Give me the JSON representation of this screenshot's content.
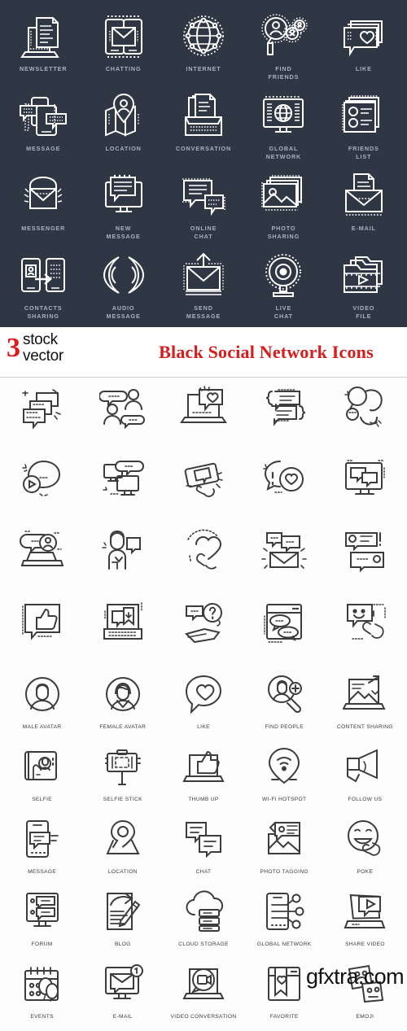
{
  "header": {
    "background_color": "#2f3744",
    "label_color": "#aab1bf",
    "icon_color": "#ffffff",
    "rows": [
      [
        {
          "label": "NEWSLETTER",
          "icon": "laptop-document-icon"
        },
        {
          "label": "CHATTING",
          "icon": "two-phones-envelope-icon"
        },
        {
          "label": "INTERNET",
          "icon": "globe-network-icon"
        },
        {
          "label": "FIND\nFRIENDS",
          "icon": "magnifier-people-icon"
        },
        {
          "label": "LIKE",
          "icon": "speech-bubble-heart-icon"
        }
      ],
      [
        {
          "label": "MESSAGE",
          "icon": "phone-chat-bubbles-icon"
        },
        {
          "label": "LOCATION",
          "icon": "map-pin-avatar-icon"
        },
        {
          "label": "CONVERSATION",
          "icon": "documents-tray-icon"
        },
        {
          "label": "GLOBAL\nNETWORK",
          "icon": "monitor-globe-icon"
        },
        {
          "label": "FRIENDS\nLIST",
          "icon": "contact-cards-icon"
        }
      ],
      [
        {
          "label": "MESSENGER",
          "icon": "open-envelope-icon"
        },
        {
          "label": "NEW\nMESSAGE",
          "icon": "monitor-message-icon"
        },
        {
          "label": "ONLINE\nCHAT",
          "icon": "chat-bubbles-icon"
        },
        {
          "label": "PHOTO\nSHARING",
          "icon": "photo-stack-icon"
        },
        {
          "label": "E-MAIL",
          "icon": "envelope-letter-icon"
        }
      ],
      [
        {
          "label": "CONTACTS\nSHARING",
          "icon": "phones-transfer-icon"
        },
        {
          "label": "AUDIO\nMESSAGE",
          "icon": "sound-wave-icon"
        },
        {
          "label": "SEND\nMESSAGE",
          "icon": "envelope-arrow-up-icon"
        },
        {
          "label": "LIVE\nCHAT",
          "icon": "webcam-icon"
        },
        {
          "label": "VIDEO\nFILE",
          "icon": "video-folder-icon"
        }
      ]
    ]
  },
  "banner": {
    "logo_number": "3",
    "logo_word_1": "stock",
    "logo_word_2": "vector",
    "logo_number_color": "#e01b1b",
    "title": "Black Social Network Icons",
    "title_color": "#d81b1b"
  },
  "gallery": {
    "icon_color": "#3c3c3c",
    "label_color": "#3a3a3a",
    "unlabeled_rows": [
      [
        {
          "icon": "chat-bubbles-stack-icon"
        },
        {
          "icon": "two-people-talking-icon"
        },
        {
          "icon": "laptop-like-bubble-icon"
        },
        {
          "icon": "code-brackets-message-icon"
        },
        {
          "icon": "hand-holding-bubbles-icon"
        }
      ],
      [
        {
          "icon": "play-bubble-icon"
        },
        {
          "icon": "monitor-chat-icon"
        },
        {
          "icon": "hand-tablet-bubble-icon"
        },
        {
          "icon": "bubble-heart-alert-icon"
        },
        {
          "icon": "monitor-two-bubbles-icon"
        }
      ],
      [
        {
          "icon": "laptop-avatar-bubbles-icon"
        },
        {
          "icon": "person-bubble-icon"
        },
        {
          "icon": "hand-heart-icon"
        },
        {
          "icon": "envelope-bubbles-icon"
        },
        {
          "icon": "avatar-message-list-icon"
        }
      ],
      [
        {
          "icon": "thumb-up-bubble-icon"
        },
        {
          "icon": "laptop-bookmark-icon"
        },
        {
          "icon": "hand-question-bubble-icon"
        },
        {
          "icon": "browser-bubbles-icon"
        },
        {
          "icon": "smiley-tap-icon"
        }
      ]
    ],
    "labeled_rows": [
      [
        {
          "label": "MALE AVATAR",
          "icon": "male-avatar-icon"
        },
        {
          "label": "FEMALE AVATAR",
          "icon": "female-avatar-icon"
        },
        {
          "label": "LIKE",
          "icon": "heart-bubble-icon"
        },
        {
          "label": "FIND PEOPLE",
          "icon": "magnifier-person-plus-icon"
        },
        {
          "label": "CONTENT SHARING",
          "icon": "laptop-share-image-icon"
        }
      ],
      [
        {
          "label": "SELFIE",
          "icon": "phone-selfie-icon"
        },
        {
          "label": "SELFIE STICK",
          "icon": "selfie-stick-icon"
        },
        {
          "label": "THUMB UP",
          "icon": "laptop-thumb-up-icon"
        },
        {
          "label": "WI-FI HOTSPOT",
          "icon": "wifi-pin-icon"
        },
        {
          "label": "FOLLOW US",
          "icon": "megaphone-icon"
        }
      ],
      [
        {
          "label": "MESSAGE",
          "icon": "phone-message-icon"
        },
        {
          "label": "LOCATION",
          "icon": "location-pin-icon"
        },
        {
          "label": "CHAT",
          "icon": "two-chat-bubbles-icon"
        },
        {
          "label": "PHOTO TAGGING",
          "icon": "photo-tag-icon"
        },
        {
          "label": "POKE",
          "icon": "smiley-poke-icon"
        }
      ],
      [
        {
          "label": "FORUM",
          "icon": "monitor-forum-icon"
        },
        {
          "label": "BLOG",
          "icon": "document-pencil-share-icon"
        },
        {
          "label": "CLOUD STORAGE",
          "icon": "cloud-server-icon"
        },
        {
          "label": "GLOBAL NETWORK",
          "icon": "phone-network-nodes-icon"
        },
        {
          "label": "SHARE VIDEO",
          "icon": "laptop-play-bubble-icon"
        }
      ],
      [
        {
          "label": "EVENTS",
          "icon": "calendar-balloons-icon"
        },
        {
          "label": "E-MAIL",
          "icon": "monitor-envelope-badge-icon"
        },
        {
          "label": "VIDEO CONVERSATION",
          "icon": "laptop-video-bubble-icon"
        },
        {
          "label": "FAVORITE",
          "icon": "browser-bookmark-heart-icon"
        },
        {
          "label": "EMOJI",
          "icon": "emoji-cards-icon"
        }
      ]
    ]
  },
  "watermark": {
    "text": "gfxtra.com"
  }
}
